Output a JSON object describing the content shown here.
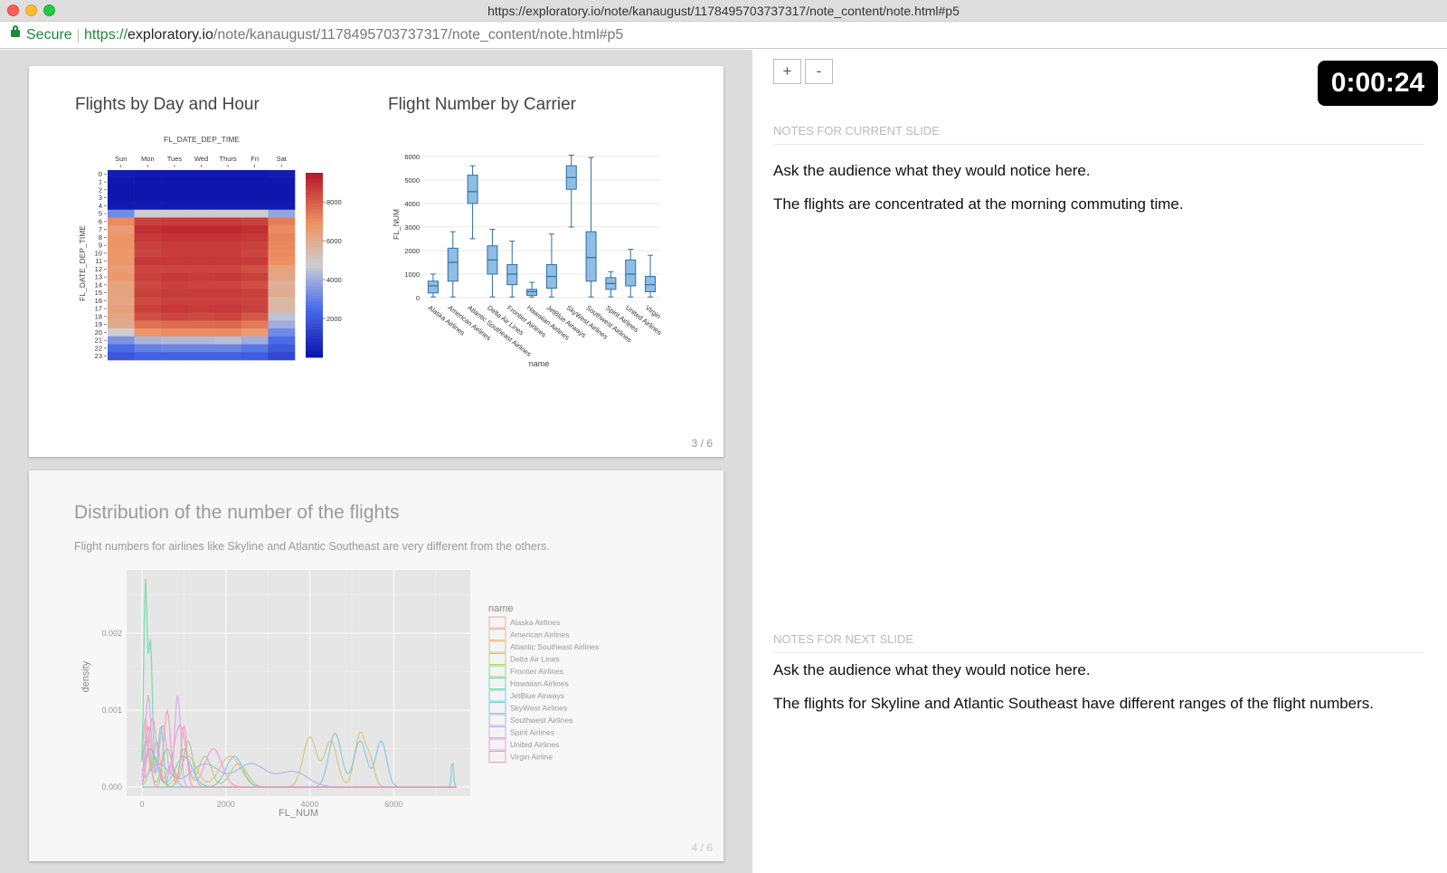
{
  "browser": {
    "title": "https://exploratory.io/note/kanaugust/1178495703737317/note_content/note.html#p5",
    "secure_label": "Secure",
    "url_scheme": "https://",
    "url_host": "exploratory.io",
    "url_path": "/note/kanaugust/1178495703737317/note_content/note.html#p5"
  },
  "slide_current": {
    "page": "3 / 6",
    "heatmap_title": "Flights by Day and Hour",
    "boxplot_title": "Flight Number by Carrier"
  },
  "slide_next": {
    "page": "4 / 6",
    "title": "Distribution of the number of the flights",
    "subtitle": "Flight numbers for airlines like Skyline and Atlantic Southeast are very different from the others."
  },
  "chart_data": [
    {
      "type": "heatmap",
      "title": "Flights by Day and Hour",
      "xlabel": "FL_DATE_DEP_TIME",
      "ylabel": "FL_DATE_DEP_TIME",
      "x_categories": [
        "Sun",
        "Mon",
        "Tues",
        "Wed",
        "Thurs",
        "Fri",
        "Sat"
      ],
      "y_categories": [
        "0",
        "1",
        "2",
        "3",
        "4",
        "5",
        "6",
        "7",
        "8",
        "9",
        "10",
        "11",
        "12",
        "13",
        "14",
        "15",
        "16",
        "17",
        "18",
        "19",
        "20",
        "21",
        "22",
        "23"
      ],
      "colorbar_ticks": [
        2000,
        4000,
        6000,
        8000
      ],
      "zlim": [
        0,
        9500
      ],
      "values": [
        [
          300,
          200,
          200,
          200,
          200,
          200,
          300
        ],
        [
          100,
          100,
          100,
          100,
          100,
          100,
          100
        ],
        [
          100,
          100,
          100,
          100,
          100,
          100,
          100
        ],
        [
          100,
          100,
          100,
          100,
          100,
          100,
          100
        ],
        [
          200,
          200,
          200,
          200,
          200,
          200,
          200
        ],
        [
          3200,
          4800,
          4800,
          4800,
          4800,
          4800,
          3800
        ],
        [
          7000,
          8600,
          8700,
          8700,
          8700,
          8600,
          7300
        ],
        [
          6500,
          9000,
          9100,
          9100,
          9100,
          9000,
          7000
        ],
        [
          6800,
          8800,
          8900,
          8900,
          8900,
          8800,
          7200
        ],
        [
          6800,
          8600,
          8700,
          8700,
          8700,
          8600,
          7100
        ],
        [
          6700,
          8500,
          8700,
          8700,
          8700,
          8500,
          7000
        ],
        [
          6700,
          8800,
          8800,
          8800,
          8800,
          8700,
          6900
        ],
        [
          6500,
          8500,
          8500,
          8500,
          8500,
          8300,
          6300
        ],
        [
          6700,
          8600,
          8800,
          8700,
          8800,
          8600,
          6200
        ],
        [
          6300,
          8400,
          8600,
          8500,
          8500,
          8300,
          5800
        ],
        [
          6300,
          8600,
          8700,
          8700,
          8700,
          8600,
          6000
        ],
        [
          6200,
          8400,
          8600,
          8600,
          8600,
          8500,
          5600
        ],
        [
          6400,
          8600,
          8800,
          8700,
          8800,
          8600,
          5600
        ],
        [
          6200,
          8300,
          8500,
          8400,
          8500,
          8100,
          4500
        ],
        [
          6100,
          7600,
          7700,
          7700,
          7800,
          7400,
          4000
        ],
        [
          4800,
          6800,
          7000,
          7000,
          7000,
          6600,
          3200
        ],
        [
          3400,
          4200,
          4300,
          4300,
          4400,
          4000,
          2500
        ],
        [
          2500,
          3000,
          3100,
          3100,
          3100,
          2800,
          2000
        ],
        [
          1900,
          2200,
          2200,
          2200,
          2200,
          2100,
          1500
        ]
      ]
    },
    {
      "type": "box",
      "title": "Flight Number by Carrier",
      "xlabel": "name",
      "ylabel": "FL_NUM",
      "ylim": [
        0,
        6300
      ],
      "yticks": [
        0,
        1000,
        2000,
        3000,
        4000,
        5000,
        6000
      ],
      "categories": [
        "Alaska Airlines",
        "American Airlines",
        "Atlantic Southeast Airlines",
        "Delta Air Lines",
        "Frontier Airlines",
        "Hawaiian Airlines",
        "JetBlue Airways",
        "SkyWest Airlines",
        "Southwest Airlines",
        "Spirit Airlines",
        "United Airlines",
        "Virgin"
      ],
      "boxes": [
        {
          "min": 30,
          "q1": 200,
          "median": 500,
          "q3": 700,
          "max": 1000
        },
        {
          "min": 30,
          "q1": 700,
          "median": 1500,
          "q3": 2100,
          "max": 2800
        },
        {
          "min": 2500,
          "q1": 4000,
          "median": 4500,
          "q3": 5200,
          "max": 5600
        },
        {
          "min": 30,
          "q1": 1000,
          "median": 1600,
          "q3": 2200,
          "max": 2900
        },
        {
          "min": 30,
          "q1": 550,
          "median": 1000,
          "q3": 1400,
          "max": 2400
        },
        {
          "min": 30,
          "q1": 100,
          "median": 250,
          "q3": 350,
          "max": 650
        },
        {
          "min": 30,
          "q1": 400,
          "median": 900,
          "q3": 1400,
          "max": 2700
        },
        {
          "min": 3000,
          "q1": 4600,
          "median": 5100,
          "q3": 5600,
          "max": 6050
        },
        {
          "min": 30,
          "q1": 700,
          "median": 1700,
          "q3": 2800,
          "max": 5950
        },
        {
          "min": 30,
          "q1": 350,
          "median": 600,
          "q3": 850,
          "max": 1100
        },
        {
          "min": 30,
          "q1": 500,
          "median": 1000,
          "q3": 1600,
          "max": 2050
        },
        {
          "min": 30,
          "q1": 250,
          "median": 550,
          "q3": 900,
          "max": 1800
        }
      ]
    },
    {
      "type": "line",
      "title": "Distribution of the number of the flights",
      "xlabel": "FL_NUM",
      "ylabel": "density",
      "xlim": [
        0,
        7500
      ],
      "ylim": [
        0,
        0.0028
      ],
      "xticks": [
        0,
        2000,
        4000,
        6000
      ],
      "yticks": [
        "0.000",
        "0.001",
        "0.002"
      ],
      "ytick_values": [
        0,
        0.001,
        0.002
      ],
      "legend_title": "name",
      "legend_position": "right",
      "series": [
        {
          "name": "Alaska Airlines",
          "color": "#f4a8a0",
          "peaks": [
            [
              80,
              0.0009,
              60
            ],
            [
              350,
              0.0006,
              80
            ],
            [
              700,
              0.0003,
              100
            ]
          ]
        },
        {
          "name": "American Airlines",
          "color": "#f1b88a",
          "peaks": [
            [
              200,
              0.0005,
              150
            ],
            [
              1100,
              0.0004,
              200
            ],
            [
              2100,
              0.0004,
              250
            ]
          ]
        },
        {
          "name": "Atlantic Southeast Airlines",
          "color": "#d9c372",
          "peaks": [
            [
              4000,
              0.00065,
              160
            ],
            [
              4500,
              0.0006,
              150
            ],
            [
              5200,
              0.0007,
              130
            ],
            [
              5450,
              0.0003,
              100
            ]
          ]
        },
        {
          "name": "Delta Air Lines",
          "color": "#b8d070",
          "peaks": [
            [
              300,
              0.0004,
              120
            ],
            [
              1000,
              0.0005,
              100
            ],
            [
              1500,
              0.0004,
              150
            ],
            [
              2300,
              0.0003,
              200
            ]
          ]
        },
        {
          "name": "Frontier Airlines",
          "color": "#8fd48a",
          "peaks": [
            [
              100,
              0.0006,
              90
            ],
            [
              600,
              0.0005,
              120
            ],
            [
              1100,
              0.0006,
              110
            ]
          ]
        },
        {
          "name": "Hawaiian Airlines",
          "color": "#6fd8a8",
          "peaks": [
            [
              80,
              0.0026,
              40
            ],
            [
              200,
              0.0019,
              50
            ],
            [
              450,
              0.0008,
              60
            ]
          ]
        },
        {
          "name": "JetBlue Airways",
          "color": "#6fd2d2",
          "peaks": [
            [
              200,
              0.0005,
              150
            ],
            [
              1000,
              0.0004,
              200
            ],
            [
              2200,
              0.0004,
              200
            ]
          ]
        },
        {
          "name": "SkyWest Airlines",
          "color": "#7ec8e8",
          "peaks": [
            [
              4600,
              0.0007,
              150
            ],
            [
              5200,
              0.0006,
              150
            ],
            [
              5700,
              0.0006,
              130
            ],
            [
              7400,
              0.00035,
              25
            ]
          ]
        },
        {
          "name": "Southwest Airlines",
          "color": "#a8b6ee",
          "peaks": [
            [
              400,
              0.0003,
              250
            ],
            [
              1500,
              0.0003,
              350
            ],
            [
              2600,
              0.0003,
              350
            ],
            [
              3600,
              0.0002,
              350
            ]
          ]
        },
        {
          "name": "Spirit Airlines",
          "color": "#d6a6ee",
          "peaks": [
            [
              150,
              0.0012,
              70
            ],
            [
              500,
              0.0008,
              90
            ],
            [
              850,
              0.0012,
              70
            ]
          ]
        },
        {
          "name": "United Airlines",
          "color": "#f09ad8",
          "peaks": [
            [
              250,
              0.0009,
              100
            ],
            [
              900,
              0.0008,
              150
            ],
            [
              1700,
              0.0005,
              200
            ]
          ]
        },
        {
          "name": "Virgin Airline",
          "color": "#f49ab4",
          "peaks": [
            [
              150,
              0.0008,
              60
            ],
            [
              600,
              0.001,
              80
            ],
            [
              1000,
              0.0008,
              70
            ]
          ]
        }
      ]
    }
  ],
  "presenter": {
    "zoom_in": "+",
    "zoom_out": "-",
    "timer": "0:00:24",
    "current_label": "NOTES FOR CURRENT SLIDE",
    "current_notes": [
      "Ask the audience what they would notice here.",
      "The flights are concentrated at the morning commuting time."
    ],
    "next_label": "NOTES FOR NEXT SLIDE",
    "next_notes": [
      "Ask the audience what they would notice here.",
      "The flights for Skyline and Atlantic Southeast have different ranges of the flight numbers."
    ]
  }
}
